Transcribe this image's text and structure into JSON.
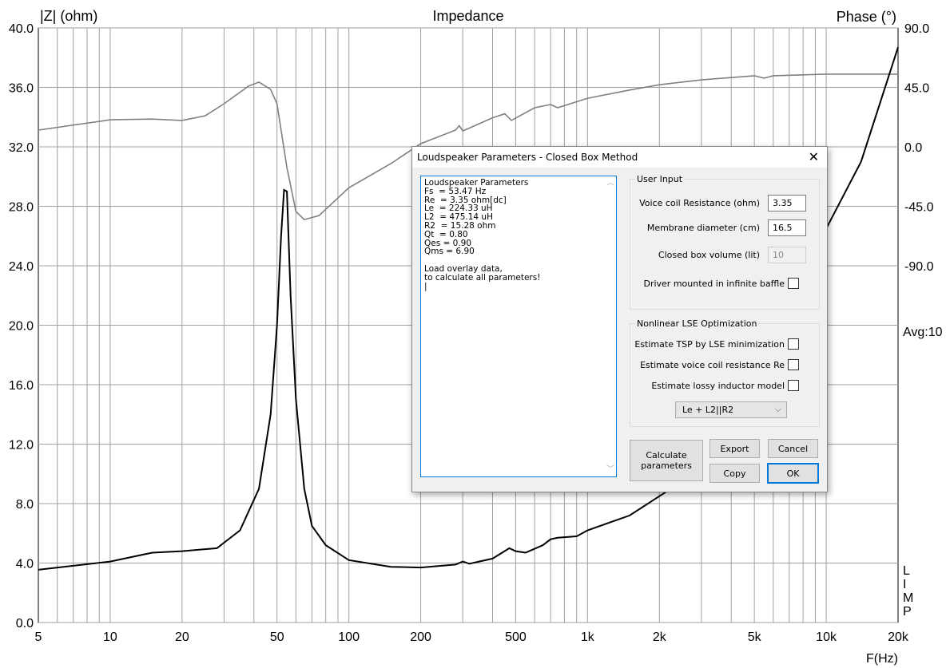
{
  "chart_data": {
    "type": "line",
    "title": "Impedance",
    "ylabel": "|Z| (ohm)",
    "y2label": "Phase (°)",
    "xlabel": "F(Hz)",
    "xscale": "log",
    "xlim": [
      5,
      20000
    ],
    "ylim": [
      0,
      40
    ],
    "y2lim": [
      -360,
      90
    ],
    "xticks": [
      5,
      10,
      20,
      50,
      100,
      200,
      500,
      1000,
      2000,
      5000,
      10000,
      20000
    ],
    "xtick_labels": [
      "5",
      "10",
      "20",
      "50",
      "100",
      "200",
      "500",
      "1k",
      "2k",
      "5k",
      "10k",
      "20k"
    ],
    "yticks": [
      "0.0",
      "4.0",
      "8.0",
      "12.0",
      "16.0",
      "20.0",
      "24.0",
      "28.0",
      "32.0",
      "36.0",
      "40.0"
    ],
    "y2ticks": [
      "90.0",
      "45.0",
      "0.0",
      "-45.0",
      "-90.0"
    ],
    "grid": true,
    "annotations": {
      "avg": "Avg:10",
      "side": [
        "L",
        "I",
        "M",
        "P"
      ]
    },
    "series": [
      {
        "name": "Impedance magnitude",
        "axis": "left",
        "color": "#000000",
        "x": [
          5,
          10,
          15,
          20,
          28,
          35,
          42,
          47,
          50,
          52,
          53.5,
          55,
          57,
          60,
          65,
          70,
          80,
          100,
          150,
          200,
          280,
          300,
          320,
          400,
          470,
          500,
          550,
          650,
          700,
          750,
          900,
          1000,
          1500,
          2000,
          2500,
          3000,
          4000,
          5000,
          6000,
          8000,
          10000,
          14000,
          20000
        ],
        "y": [
          3.55,
          4.1,
          4.7,
          4.8,
          5.0,
          6.2,
          9,
          14,
          20,
          26,
          29.1,
          29,
          22,
          15,
          9,
          6.5,
          5.2,
          4.2,
          3.75,
          3.7,
          3.9,
          4.1,
          3.95,
          4.3,
          5.0,
          4.8,
          4.7,
          5.2,
          5.6,
          5.7,
          5.8,
          6.2,
          7.2,
          8.5,
          9.5,
          11,
          14,
          17,
          19.5,
          24,
          26.5,
          31,
          38.7
        ]
      },
      {
        "name": "Phase",
        "axis": "right",
        "color": "#808080",
        "x": [
          5,
          10,
          15,
          20,
          25,
          30,
          38,
          42,
          47,
          50,
          55,
          60,
          65,
          75,
          100,
          150,
          200,
          280,
          290,
          300,
          400,
          450,
          480,
          600,
          700,
          750,
          1000,
          1500,
          2000,
          3000,
          5000,
          5500,
          6000,
          10000,
          20000
        ],
        "y": [
          12.7,
          20.5,
          21,
          20,
          23.5,
          32.6,
          46,
          49,
          43.5,
          32.6,
          -15.7,
          -49,
          -55,
          -52,
          -31,
          -12.7,
          2.4,
          12.7,
          16,
          12,
          22,
          25,
          20,
          29.6,
          32,
          29.6,
          36.8,
          43,
          47,
          50.7,
          53.8,
          52,
          53.8,
          55,
          55
        ]
      }
    ]
  },
  "dialog": {
    "title": "Loudspeaker Parameters - Closed Box Method",
    "output_text": "Loudspeaker Parameters\nFs  = 53.47 Hz\nRe  = 3.35 ohm[dc]\nLe  = 224.33 uH\nL2  = 475.14 uH\nR2  = 15.28 ohm\nQt  = 0.80\nQes = 0.90\nQms = 6.90\n\nLoad overlay data,\nto calculate all parameters!\n|",
    "user_input": {
      "title": "User Input",
      "voice_coil_label": "Voice coil Resistance (ohm)",
      "voice_coil_value": "3.35",
      "membrane_label": "Membrane diameter (cm)",
      "membrane_value": "16.5",
      "box_label": "Closed box volume (lit)",
      "box_value": "10",
      "baffle_label": "Driver mounted in infinite baffle"
    },
    "lse": {
      "title": "Nonlinear LSE Optimization",
      "tsp_label": "Estimate TSP by LSE minimization",
      "re_label": "Estimate voice coil resistance Re",
      "lossy_label": "Estimate lossy inductor model",
      "model_selected": "Le + L2||R2"
    },
    "buttons": {
      "calculate": "Calculate parameters",
      "export": "Export",
      "cancel": "Cancel",
      "copy": "Copy",
      "ok": "OK"
    }
  }
}
